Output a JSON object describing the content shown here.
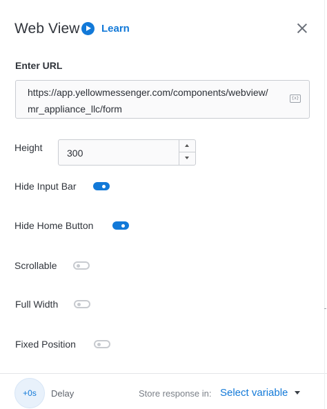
{
  "header": {
    "title": "Web View",
    "learn_label": "Learn",
    "play_icon": "play-circle-icon",
    "close_icon": "close-icon"
  },
  "url": {
    "label": "Enter URL",
    "value": "https://app.yellowmessenger.com/components/webview/mr_appliance_llc/form",
    "variable_icon": "variable-insert-icon",
    "variable_icon_text": "{x}"
  },
  "height": {
    "label": "Height",
    "value": "300"
  },
  "toggles": [
    {
      "label": "Hide Input Bar",
      "state": "on"
    },
    {
      "label": "Hide Home Button",
      "state": "on"
    },
    {
      "label": "Scrollable",
      "state": "off"
    },
    {
      "label": "Full Width",
      "state": "off"
    },
    {
      "label": "Fixed Position",
      "state": "off"
    }
  ],
  "footer": {
    "delay_value": "+0s",
    "delay_label": "Delay",
    "store_label": "Store response in:",
    "select_label": "Select variable",
    "dropdown_icon": "caret-down-icon"
  },
  "colors": {
    "accent": "#1279d8",
    "toggle_off": "#c7cacf",
    "border": "#c9ccd1"
  }
}
